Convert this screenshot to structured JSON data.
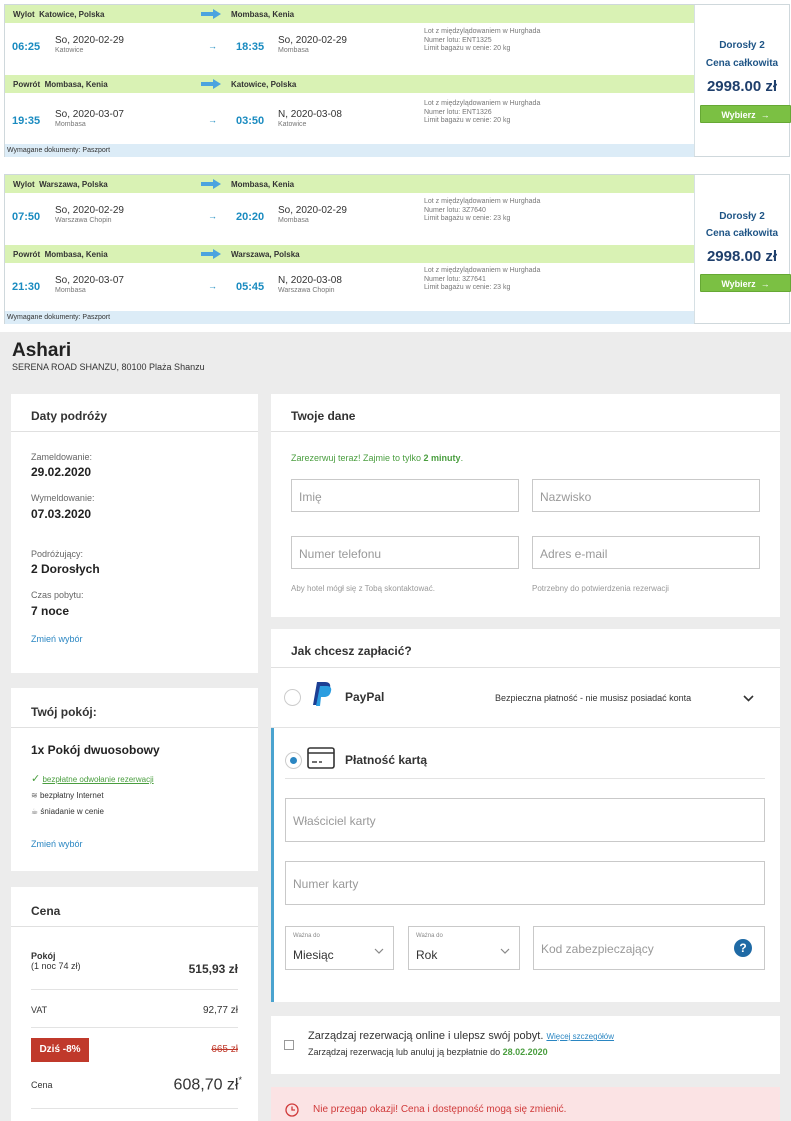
{
  "flights": [
    {
      "outbound": {
        "label": "Wylot",
        "from": "Katowice, Polska",
        "to": "Mombasa, Kenia",
        "dep_time": "06:25",
        "dep_date": "So, 2020-02-29",
        "dep_city": "Katowice",
        "arr_time": "18:35",
        "arr_date": "So, 2020-02-29",
        "arr_city": "Mombasa",
        "info1": "Lot z międzylądowaniem w Hurghada",
        "info2": "Numer lotu: ENT1325",
        "info3": "Limit bagażu w cenie: 20 kg"
      },
      "return": {
        "label": "Powrót",
        "from": "Mombasa, Kenia",
        "to": "Katowice, Polska",
        "dep_time": "19:35",
        "dep_date": "So, 2020-03-07",
        "dep_city": "Mombasa",
        "arr_time": "03:50",
        "arr_date": "N, 2020-03-08",
        "arr_city": "Katowice",
        "info1": "Lot z międzylądowaniem w Hurghada",
        "info2": "Numer lotu: ENT1326",
        "info3": "Limit bagażu w cenie: 20 kg"
      },
      "docs": "Wymagane dokumenty: Paszport",
      "pax": "Dorosły 2",
      "total_label": "Cena całkowita",
      "price": "2998.00 zł",
      "button": "Wybierz",
      "arrow_glyph": "→"
    },
    {
      "outbound": {
        "label": "Wylot",
        "from": "Warszawa, Polska",
        "to": "Mombasa, Kenia",
        "dep_time": "07:50",
        "dep_date": "So, 2020-02-29",
        "dep_city": "Warszawa Chopin",
        "arr_time": "20:20",
        "arr_date": "So, 2020-02-29",
        "arr_city": "Mombasa",
        "info1": "Lot z międzylądowaniem w Hurghada",
        "info2": "Numer lotu: 3Z7640",
        "info3": "Limit bagażu w cenie: 23 kg"
      },
      "return": {
        "label": "Powrót",
        "from": "Mombasa, Kenia",
        "to": "Warszawa, Polska",
        "dep_time": "21:30",
        "dep_date": "So, 2020-03-07",
        "dep_city": "Mombasa",
        "arr_time": "05:45",
        "arr_date": "N, 2020-03-08",
        "arr_city": "Warszawa Chopin",
        "info1": "Lot z międzylądowaniem w Hurghada",
        "info2": "Numer lotu: 3Z7641",
        "info3": "Limit bagażu w cenie: 23 kg"
      },
      "docs": "Wymagane dokumenty: Paszport",
      "pax": "Dorosły 2",
      "total_label": "Cena całkowita",
      "price": "2998.00 zł",
      "button": "Wybierz",
      "arrow_glyph": "→"
    }
  ],
  "hotel": {
    "name": "Ashari",
    "address": "SERENA ROAD SHANZU, 80100 Plaża Shanzu"
  },
  "dates_panel": {
    "title": "Daty podróży",
    "checkin_label": "Zameldowanie:",
    "checkin": "29.02.2020",
    "checkout_label": "Wymeldowanie:",
    "checkout": "07.03.2020",
    "travelers_label": "Podróżujący:",
    "travelers": "2 Dorosłych",
    "stay_label": "Czas pobytu:",
    "stay": "7 noce",
    "change": "Zmień wybór"
  },
  "room_panel": {
    "title": "Twój pokój:",
    "room": "1x Pokój dwuosobowy",
    "feature1": "bezpłatne odwołanie rezerwacji",
    "feature2": "bezpłatny Internet",
    "feature3": "śniadanie w cenie",
    "change": "Zmień wybór"
  },
  "price_panel": {
    "title": "Cena",
    "room_label": "Pokój",
    "room_sub": "(1 noc 74 zł)",
    "room_price": "515,93 zł",
    "vat_label": "VAT",
    "vat": "92,77 zł",
    "discount": "Dziś -8%",
    "old_price": "665 zł",
    "total_label": "Cena",
    "total": "608,70 zł",
    "asterisk": "*"
  },
  "your_data": {
    "title": "Twoje dane",
    "promo_prefix": "Zarezerwuj teraz! Zajmie to tylko ",
    "promo_bold": "2 minuty",
    "promo_suffix": ".",
    "first_name": "Imię",
    "last_name": "Nazwisko",
    "phone": "Numer telefonu",
    "email": "Adres e-mail",
    "phone_hint": "Aby hotel mógł się z Tobą skontaktować.",
    "email_hint": "Potrzebny do potwierdzenia rezerwacji"
  },
  "payment": {
    "title": "Jak chcesz zapłacić?",
    "paypal": "PayPal",
    "paypal_note": "Bezpieczna płatność - nie musisz posiadać konta",
    "card": "Płatność kartą",
    "card_owner": "Właściciel karty",
    "card_number": "Numer karty",
    "valid_label": "Ważna do",
    "month": "Miesiąc",
    "year": "Rok",
    "cvv": "Kod zabezpieczający",
    "help": "?"
  },
  "manage": {
    "line1": "Zarządzaj rezerwacją online i ulepsz swój pobyt.",
    "more": "Więcej szczegółów",
    "line2_prefix": "Zarządzaj rezerwacją lub anuluj ją bezpłatnie do ",
    "line2_date": "28.02.2020"
  },
  "warning": {
    "text": "Nie przegap okazji! Cena i dostępność mogą się zmienić."
  },
  "colors": {
    "accent": "#1a8bc0",
    "header_green": "#d9f2b4",
    "button_green": "#7bc043",
    "promo_green": "#4a9e3f",
    "discount_red": "#c0392b",
    "warning_bg": "#fbe3e4"
  }
}
